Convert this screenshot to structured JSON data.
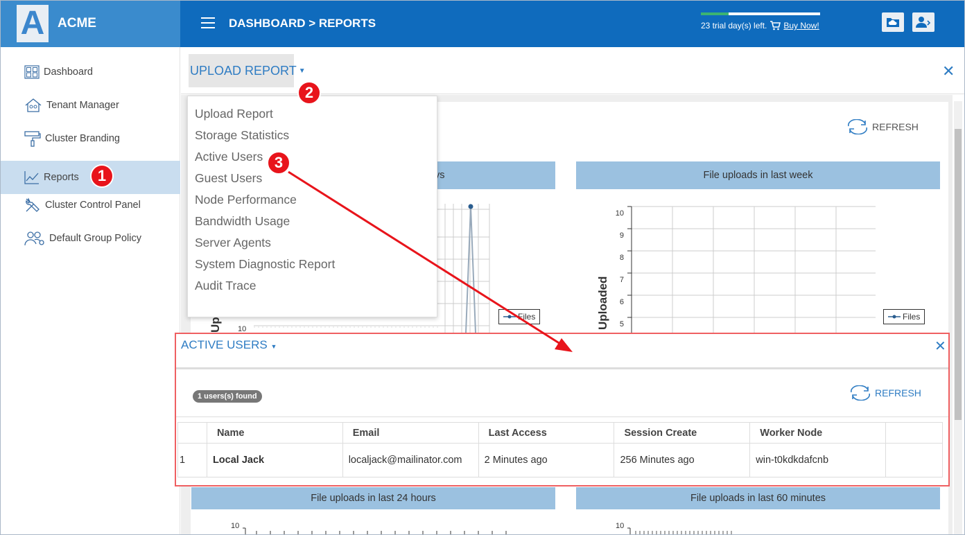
{
  "brand": {
    "logo_letter": "A",
    "name": "ACME"
  },
  "header": {
    "breadcrumb": "DASHBOARD > REPORTS",
    "trial_text": "23 trial day(s) left.",
    "buy_now": "Buy Now!",
    "trial_progress": 0.23
  },
  "sidebar": {
    "items": [
      {
        "label": "Dashboard",
        "icon": "dashboard-icon"
      },
      {
        "label": "Tenant Manager",
        "icon": "tenant-icon"
      },
      {
        "label": "Cluster Branding",
        "icon": "paint-roller-icon"
      },
      {
        "label": "Reports",
        "icon": "chart-icon",
        "active": true
      },
      {
        "label": "Cluster Control Panel",
        "icon": "tools-icon"
      },
      {
        "label": "Default Group Policy",
        "icon": "group-policy-icon"
      }
    ]
  },
  "annotations": {
    "step1": "1",
    "step2": "2",
    "step3": "3"
  },
  "toolbar": {
    "upload_report": "UPLOAD REPORT",
    "refresh": "REFRESH"
  },
  "dropdown": {
    "items": [
      "Upload Report",
      "Storage Statistics",
      "Active Users",
      "Guest Users",
      "Node Performance",
      "Bandwidth Usage",
      "Server Agents",
      "System Diagnostic Report",
      "Audit Trace"
    ]
  },
  "charts": {
    "panel1_title_fragment": "ys",
    "panel2_title": "File uploads in last week",
    "panel3_title": "File uploads in last 24 hours",
    "panel4_title": "File uploads in last 60 minutes",
    "legend": "Files",
    "ylabel_fragment": "Up",
    "ylabel2_fragment": "Uploaded",
    "tick_10": "10",
    "week_yticks": [
      "10",
      "9",
      "8",
      "7",
      "6",
      "5"
    ]
  },
  "chart_data": [
    {
      "type": "line",
      "title": "File uploads in last week",
      "series": [
        {
          "name": "Files",
          "values": []
        }
      ],
      "ylabel": "Uploaded",
      "ylim": [
        5,
        10
      ],
      "yticks": [
        10,
        9,
        8,
        7,
        6,
        5
      ]
    }
  ],
  "active_users": {
    "title": "ACTIVE USERS",
    "users_found": "1 users(s) found",
    "refresh": "REFRESH",
    "columns": [
      "",
      "Name",
      "Email",
      "Last Access",
      "Session Create",
      "Worker Node",
      ""
    ],
    "rows": [
      {
        "index": "1",
        "name": "Local Jack",
        "email": "localjack@mailinator.com",
        "last_access": "2 Minutes ago",
        "session_create": "256 Minutes ago",
        "worker_node": "win-t0kdkdafcnb"
      }
    ]
  },
  "colors": {
    "header": "#0f6bbd",
    "brand": "#3a8bcd",
    "accent": "#2e7cc3",
    "annotation": "#e8141b",
    "active_sidebar": "#c9ddef"
  }
}
